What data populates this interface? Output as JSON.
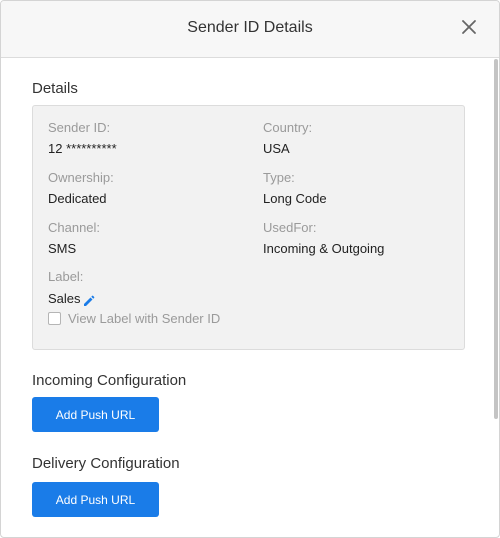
{
  "modal": {
    "title": "Sender ID Details",
    "close_icon": "close-icon"
  },
  "details": {
    "section_title": "Details",
    "sender_id": {
      "label": "Sender ID:",
      "value": "12 **********"
    },
    "country": {
      "label": "Country:",
      "value": "USA"
    },
    "ownership": {
      "label": "Ownership:",
      "value": "Dedicated"
    },
    "type": {
      "label": "Type:",
      "value": "Long Code"
    },
    "channel": {
      "label": "Channel:",
      "value": "SMS"
    },
    "used_for": {
      "label": "UsedFor:",
      "value": "Incoming & Outgoing"
    },
    "label": {
      "label": "Label:",
      "value": "Sales",
      "edit_icon": "pencil-icon"
    },
    "view_label_checkbox": {
      "label": "View Label with Sender ID",
      "checked": false
    }
  },
  "incoming": {
    "section_title": "Incoming Configuration",
    "button_label": "Add Push URL"
  },
  "delivery": {
    "section_title": "Delivery Configuration",
    "button_label": "Add Push URL"
  },
  "colors": {
    "accent": "#1a7ce8",
    "header_bg": "#f7f7f7",
    "details_bg": "#f2f2f2"
  }
}
